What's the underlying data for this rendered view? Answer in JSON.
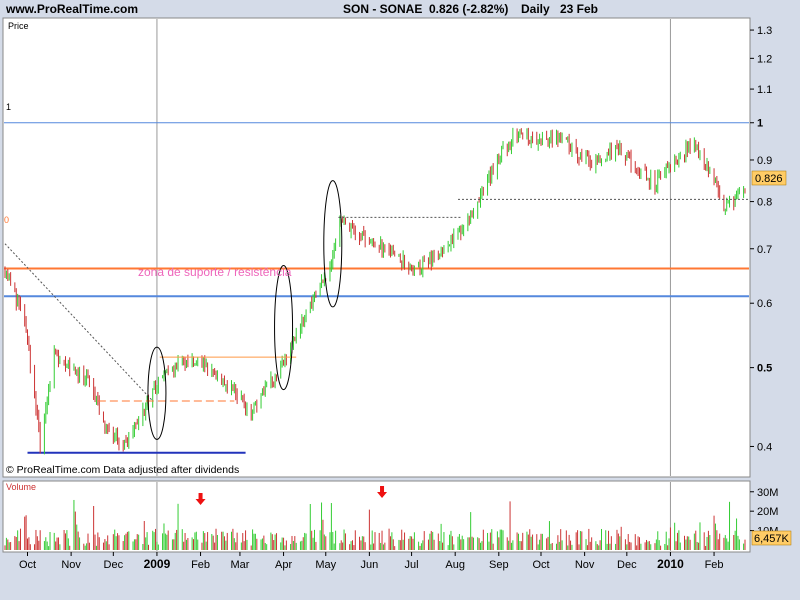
{
  "header": {
    "site": "www.ProRealTime.com",
    "symbol": "SON - SONAE",
    "last_change": "0.826 (-2.82%)",
    "period": "Daily",
    "date": "23 Feb"
  },
  "price_panel": {
    "label": "Price",
    "left_marker": "1",
    "left_marker2": "0",
    "footer_note": "© ProRealTime.com  Data adjusted after dividends",
    "annotation": "zona de suporte / resistência",
    "last_price_tag": "0.826"
  },
  "volume_panel": {
    "label": "Volume",
    "last_volume_tag": "6,457K"
  },
  "colors": {
    "up": "#33cc33",
    "down": "#cc3333",
    "background": "#ffffff",
    "frame": "#d4dbe8",
    "orange_line": "#ff7733",
    "blue_line": "#5588dd",
    "support_line": "#2233bb",
    "annotation": "#ee66bb",
    "arrow": "#ee1111",
    "price_tag": "#ffcc66",
    "volume_tag": "#ffcc66"
  },
  "chart_data": [
    {
      "type": "candlestick",
      "title": "SON - SONAE",
      "ylabel": "Price",
      "y_scale": "log",
      "ylim": [
        0.37,
        1.33
      ],
      "y_ticks": [
        "1.3",
        "1.2",
        "1.1",
        "1",
        "0.9",
        "0.8",
        "0.7",
        "0.6",
        "0.5",
        "0.4"
      ],
      "x_ticks": [
        "Oct",
        "Nov",
        "Dec",
        "2009",
        "Feb",
        "Mar",
        "Apr",
        "May",
        "Jun",
        "Jul",
        "Aug",
        "Sep",
        "Oct",
        "Nov",
        "Dec",
        "2010",
        "Feb"
      ],
      "date_range": [
        "2008-09-15",
        "2010-02-23"
      ],
      "last_close": 0.826,
      "change_pct": -2.82,
      "horizontal_lines": [
        {
          "kind": "resistance",
          "value": 0.662,
          "color": "#ff7733"
        },
        {
          "kind": "support",
          "value": 0.612,
          "color": "#5588dd"
        },
        {
          "kind": "low-support",
          "value": 0.393,
          "color": "#2233bb"
        },
        {
          "kind": "reference",
          "value": 1.0,
          "color": "#5588dd"
        }
      ],
      "trendline": {
        "from": [
          "2008-09-15",
          0.71
        ],
        "to": [
          "2008-12-29",
          0.455
        ]
      },
      "approx_closes": [
        [
          "2008-09-15",
          0.66
        ],
        [
          "2008-09-29",
          0.57
        ],
        [
          "2008-10-10",
          0.4
        ],
        [
          "2008-10-20",
          0.52
        ],
        [
          "2008-11-03",
          0.5
        ],
        [
          "2008-11-14",
          0.48
        ],
        [
          "2008-11-24",
          0.43
        ],
        [
          "2008-12-08",
          0.4
        ],
        [
          "2008-12-22",
          0.44
        ],
        [
          "2009-01-05",
          0.49
        ],
        [
          "2009-01-19",
          0.51
        ],
        [
          "2009-02-09",
          0.5
        ],
        [
          "2009-02-23",
          0.47
        ],
        [
          "2009-03-09",
          0.44
        ],
        [
          "2009-03-23",
          0.48
        ],
        [
          "2009-04-06",
          0.53
        ],
        [
          "2009-04-20",
          0.6
        ],
        [
          "2009-05-04",
          0.66
        ],
        [
          "2009-05-11",
          0.76
        ],
        [
          "2009-05-25",
          0.73
        ],
        [
          "2009-06-08",
          0.71
        ],
        [
          "2009-06-22",
          0.68
        ],
        [
          "2009-07-06",
          0.66
        ],
        [
          "2009-07-20",
          0.69
        ],
        [
          "2009-08-03",
          0.73
        ],
        [
          "2009-08-17",
          0.8
        ],
        [
          "2009-08-31",
          0.9
        ],
        [
          "2009-09-14",
          0.97
        ],
        [
          "2009-09-28",
          0.95
        ],
        [
          "2009-10-12",
          0.97
        ],
        [
          "2009-10-26",
          0.92
        ],
        [
          "2009-11-09",
          0.89
        ],
        [
          "2009-11-23",
          0.93
        ],
        [
          "2009-12-07",
          0.88
        ],
        [
          "2009-12-21",
          0.84
        ],
        [
          "2010-01-04",
          0.9
        ],
        [
          "2010-01-18",
          0.94
        ],
        [
          "2010-02-01",
          0.85
        ],
        [
          "2010-02-08",
          0.78
        ],
        [
          "2010-02-23",
          0.826
        ]
      ]
    },
    {
      "type": "bar",
      "title": "Volume",
      "ylim": [
        0,
        34
      ],
      "y_ticks": [
        "30M",
        "20M",
        "10M"
      ]
    }
  ]
}
